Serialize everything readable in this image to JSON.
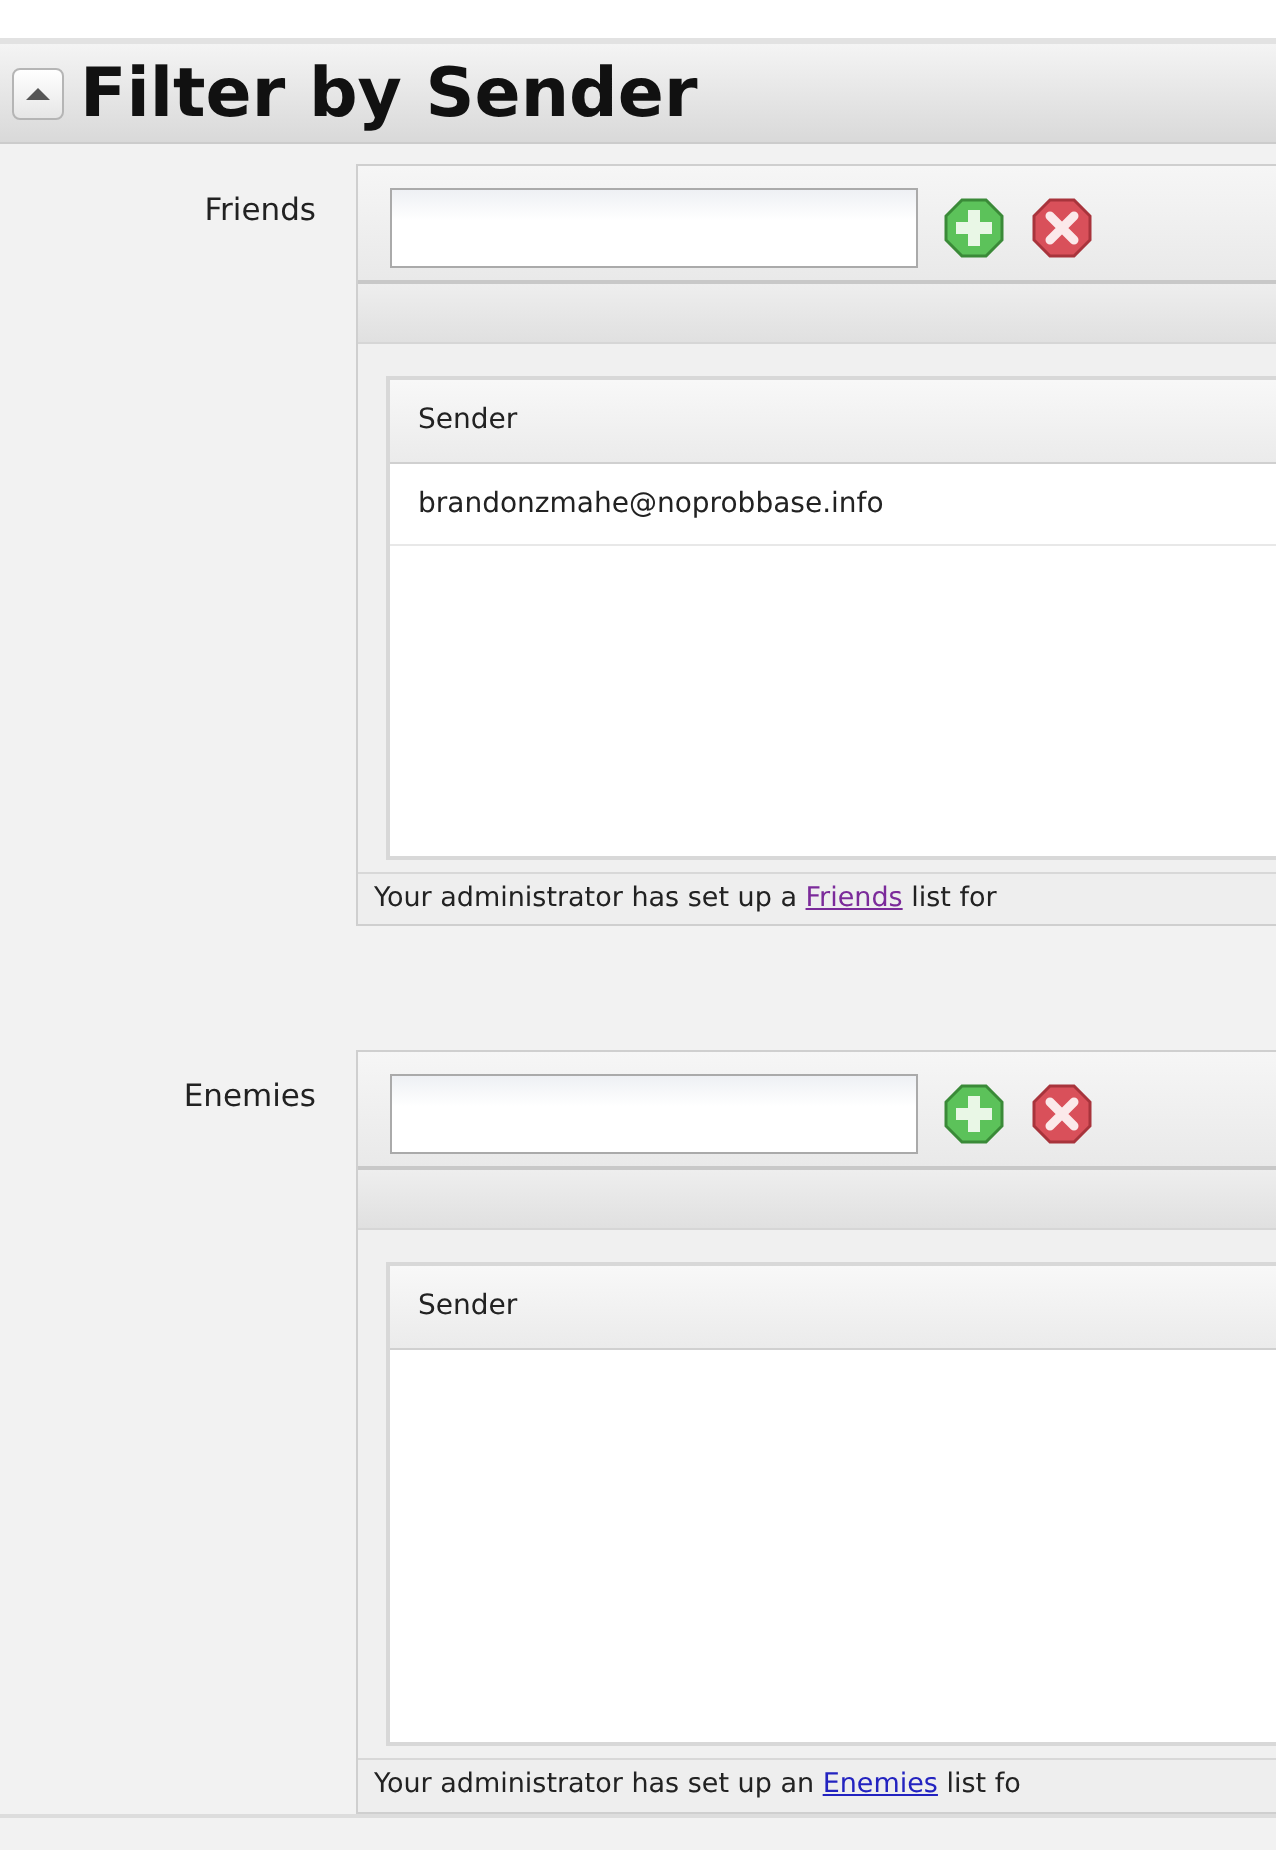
{
  "section": {
    "title": "Filter by Sender",
    "expanded": true
  },
  "lists": [
    {
      "label": "Friends",
      "column": "Sender",
      "rows": [
        "brandonzmahe@noprobbase.info"
      ],
      "note": {
        "before": "Your administrator has set up a ",
        "link": "Friends",
        "link_visited": true,
        "after": " list for"
      }
    },
    {
      "label": "Enemies",
      "column": "Sender",
      "note": {
        "before": "Your administrator has set up an ",
        "link": "Enemies",
        "link_visited": false,
        "after": " list fo"
      }
    }
  ]
}
